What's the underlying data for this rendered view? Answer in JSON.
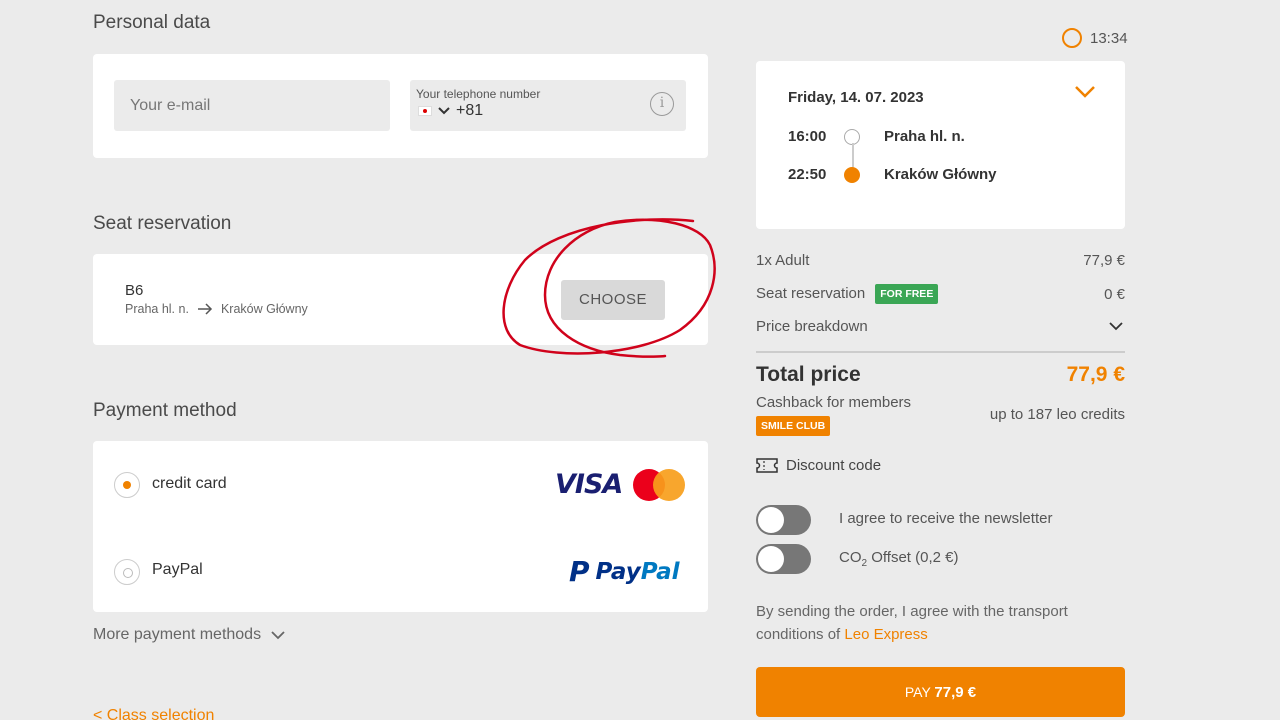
{
  "personal": {
    "title": "Personal data",
    "email_placeholder": "Your e-mail",
    "phone_label": "Your telephone number",
    "phone_prefix": "+81"
  },
  "seat": {
    "title": "Seat reservation",
    "seat_id": "B6",
    "from": "Praha hl. n.",
    "to": "Kraków Główny",
    "choose_label": "CHOOSE"
  },
  "payment": {
    "title": "Payment method",
    "options": [
      {
        "label": "credit card",
        "selected": true
      },
      {
        "label": "PayPal",
        "selected": false
      }
    ],
    "visa_text": "VISA",
    "paypal_text_a": "Pay",
    "paypal_text_b": "Pal",
    "more_label": "More payment methods",
    "class_selection_label": "< Class selection"
  },
  "summary": {
    "timer": "13:34",
    "date": "Friday, 14. 07. 2023",
    "departure_time": "16:00",
    "departure_station": "Praha hl. n.",
    "arrival_time": "22:50",
    "arrival_station": "Kraków Główny",
    "adult_label": "1x Adult",
    "adult_price": "77,9 €",
    "seat_label": "Seat reservation",
    "free_badge": "FOR FREE",
    "seat_price": "0 €",
    "breakdown_label": "Price breakdown",
    "total_label": "Total price",
    "total_value": "77,9 €",
    "cashback_label": "Cashback for members",
    "smile_badge": "SMILE CLUB",
    "cashback_value": "up to 187 leo credits",
    "discount_label": "Discount code",
    "newsletter_label": "I agree to receive the newsletter",
    "co2_label_a": "CO",
    "co2_sub": "2",
    "co2_label_b": " Offset (0,2 €)",
    "terms_text": "By sending the order, I agree with the transport conditions of ",
    "terms_link": "Leo Express",
    "pay_prefix": "PAY ",
    "pay_amount": "77,9 €"
  },
  "colors": {
    "accent": "#f08200",
    "free_badge": "#3aa655",
    "annotation": "#d0021b"
  },
  "icons": [
    "japan-flag-icon",
    "chevron-down-icon",
    "info-icon",
    "arrow-right-icon",
    "timer-icon",
    "ticket-icon",
    "visa-logo",
    "mastercard-logo",
    "paypal-logo"
  ]
}
